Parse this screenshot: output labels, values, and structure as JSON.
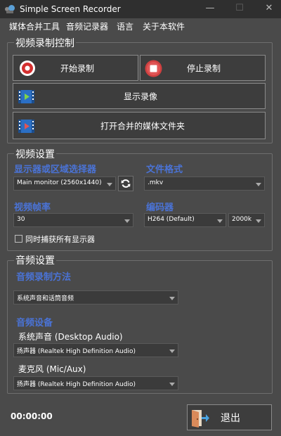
{
  "window": {
    "title": "Simple Screen Recorder",
    "minimize_glyph": "—",
    "maximize_glyph": "☐",
    "close_glyph": "✕"
  },
  "menu": {
    "items": [
      "媒体合并工具",
      "音频记录器",
      "语言",
      "关于本软件"
    ]
  },
  "video_control": {
    "title": "视频录制控制",
    "start_label": "开始录制",
    "stop_label": "停止录制",
    "show_label": "显示录像",
    "open_folder_label": "打开合并的媒体文件夹"
  },
  "video_settings": {
    "title": "视频设置",
    "display_label": "显示器或区域选择器",
    "display_value": "Main monitor (2560x1440)",
    "format_label": "文件格式",
    "format_value": ".mkv",
    "fps_label": "视频帧率",
    "fps_value": "30",
    "encoder_label": "编码器",
    "encoder_value": "H264 (Default)",
    "bitrate_value": "2000k",
    "capture_all_label": "同时捕获所有显示器",
    "capture_all_checked": false
  },
  "audio_settings": {
    "title": "音频设置",
    "method_label": "音频录制方法",
    "method_value": "系统声音和话筒音频",
    "device_label": "音频设备",
    "system_audio_label": "系统声音 (Desktop Audio)",
    "system_audio_value": "扬声器 (Realtek High Definition Audio)",
    "mic_label": "麦克风 (Mic/Aux)",
    "mic_value": "扬声器 (Realtek High Definition Audio)"
  },
  "footer": {
    "timer": "00:00:00",
    "exit_label": "退出"
  },
  "colors": {
    "background": "#4a4a4a",
    "titlebar": "#2f2f2f",
    "accent_label": "#4a73d6",
    "record_red": "#d32f2f"
  },
  "icons": {
    "app": "app-logo-icon",
    "start": "record-icon",
    "stop": "stop-icon",
    "show": "film-play-icon",
    "folder": "film-folder-icon",
    "refresh": "refresh-icon",
    "exit": "exit-door-icon"
  }
}
